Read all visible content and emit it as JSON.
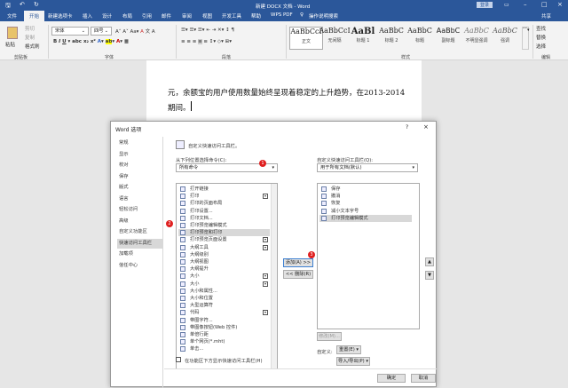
{
  "app": {
    "title": "新建 DOCX 文档 - Word",
    "login": "登录",
    "share": "共享"
  },
  "tabs": [
    "文件",
    "开始",
    "新建选项卡",
    "插入",
    "设计",
    "布局",
    "引用",
    "邮件",
    "审阅",
    "视图",
    "开发工具",
    "帮助",
    "WPS PDF"
  ],
  "tell_me": "操作说明搜索",
  "ribbon": {
    "clipboard": {
      "paste": "粘贴",
      "cut": "剪切",
      "copy": "复制",
      "format_painter": "格式刷",
      "label": "剪贴板"
    },
    "font": {
      "name": "宋体",
      "size": "四号",
      "label": "字体"
    },
    "paragraph": {
      "label": "段落"
    },
    "styles": {
      "label": "样式",
      "items": [
        {
          "sample": "AaBbCcI",
          "name": "正文"
        },
        {
          "sample": "AaBbCcI",
          "name": "无间隔"
        },
        {
          "sample": "AaBl",
          "name": "标题 1"
        },
        {
          "sample": "AaBbC",
          "name": "标题 2"
        },
        {
          "sample": "AaBbC",
          "name": "标题"
        },
        {
          "sample": "AaBbC",
          "name": "副标题"
        },
        {
          "sample": "AaBbC",
          "name": "不明显强调"
        },
        {
          "sample": "AaBbC",
          "name": "强调"
        }
      ]
    },
    "editing": {
      "find": "查找",
      "replace": "替换",
      "select": "选择",
      "label": "编辑"
    }
  },
  "document": {
    "line1": "元，余额宝的用户使用数量始终呈现着稳定的上升趋势，在2013-2014",
    "line2": "期间。"
  },
  "dialog": {
    "title": "Word 选项",
    "help": "?",
    "close": "×",
    "nav": [
      "常规",
      "显示",
      "校对",
      "保存",
      "版式",
      "语言",
      "轻松访问",
      "高级",
      "自定义功能区",
      "快速访问工具栏",
      "加载项",
      "信任中心"
    ],
    "nav_selected": 9,
    "header": "自定义快速访问工具栏。",
    "choose_label": "从下列位置选择命令(C):",
    "choose_value": "所有命令",
    "commands": [
      "打开链接",
      "打印",
      "打印的页面布局",
      "打印设置...",
      "打印文档...",
      "打印预览编辑模式",
      "打印预览和打印",
      "打印预览页面设置",
      "大纲工具",
      "大纲级别",
      "大纲视图",
      "大纲提升",
      "大小",
      "大小",
      "大小和属性...",
      "大小和位置",
      "大型运算符",
      "代码",
      "带圈字符...",
      "带图像按钮(Web 控件)",
      "单倍行距",
      "单个网页(*.mht)",
      "单击..."
    ],
    "commands_selected": 6,
    "customize_label": "自定义快速访问工具栏(Q):",
    "customize_value": "用于所有文档(默认)",
    "qat_items": [
      "保存",
      "撤消",
      "恢复",
      "减小文本字号",
      "打印预览编辑模式"
    ],
    "qat_selected": 4,
    "add_button": "添加(A) >>",
    "remove_button": "<< 删除(R)",
    "modify_button": "修改(M)...",
    "customize_text": "自定义:",
    "reset_button": "重置(E) ▾",
    "import_export_button": "导入/导出(P) ▾",
    "show_below_checkbox": "在功能区下方显示快速访问工具栏(H)",
    "ok": "确定",
    "cancel": "取消",
    "badges": [
      "1",
      "2",
      "3"
    ]
  },
  "colors": {
    "brand": "#2b579a",
    "badge": "#e02020"
  }
}
